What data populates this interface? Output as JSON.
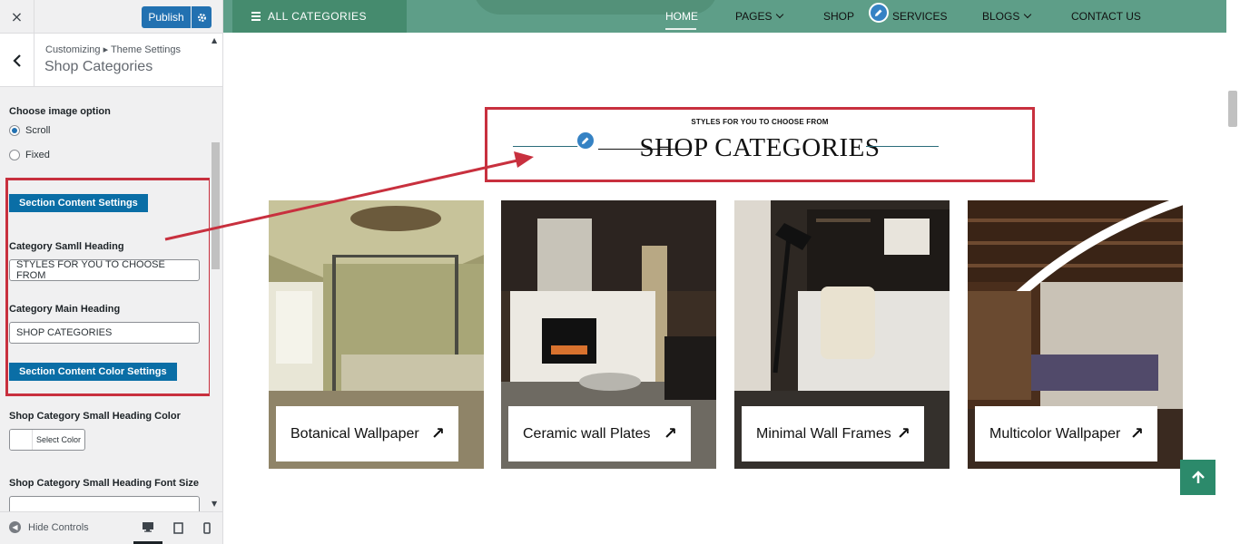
{
  "sidebar": {
    "close_icon": "×",
    "publish_label": "Publish",
    "breadcrumb": "Customizing ▸ Theme Settings",
    "section_title": "Shop Categories",
    "image_option_label": "Choose image option",
    "image_options": [
      {
        "label": "Scroll",
        "checked": true
      },
      {
        "label": "Fixed",
        "checked": false
      }
    ],
    "content_settings_btn": "Section Content Settings",
    "small_heading_label": "Category Samll Heading",
    "small_heading_value": "STYLES FOR YOU TO CHOOSE FROM",
    "main_heading_label": "Category Main Heading",
    "main_heading_value": "SHOP CATEGORIES",
    "color_settings_btn": "Section Content Color Settings",
    "small_heading_color_label": "Shop Category Small Heading Color",
    "select_color_label": "Select Color",
    "small_heading_font_label": "Shop Category Small Heading Font Size",
    "small_heading_font_value": "",
    "hide_controls_label": "Hide Controls"
  },
  "nav": {
    "all_categories": "ALL CATEGORIES",
    "items": [
      {
        "label": "HOME",
        "active": true
      },
      {
        "label": "PAGES",
        "dropdown": true
      },
      {
        "label": "SHOP"
      },
      {
        "label": "SERVICES"
      },
      {
        "label": "BLOGS",
        "dropdown": true
      },
      {
        "label": "CONTACT US"
      }
    ]
  },
  "section": {
    "small_heading": "STYLES FOR YOU TO CHOOSE FROM",
    "main_heading": "SHOP CATEGORIES"
  },
  "categories": [
    {
      "title": "Botanical Wallpaper",
      "arrow": "↗"
    },
    {
      "title": "Ceramic wall Plates",
      "arrow": "↗"
    },
    {
      "title": "Minimal Wall Frames",
      "arrow": "↗"
    },
    {
      "title": "Multicolor Wallpaper",
      "arrow": "↗"
    }
  ],
  "colors": {
    "nav_bg": "#5e9e88",
    "all_cat_bg": "#458b6e",
    "publish": "#2271b1",
    "section_btn": "#0a6ea6",
    "annotation": "#c8303e",
    "back_to_top": "#2c8a6b"
  },
  "icons": {
    "close": "close-icon",
    "back": "chevron-left-icon",
    "gear": "gear-icon",
    "hamburger": "hamburger-icon",
    "edit": "pencil-icon",
    "back_to_top": "arrow-up-icon",
    "desktop": "desktop-icon",
    "tablet": "tablet-icon",
    "mobile": "mobile-icon"
  }
}
